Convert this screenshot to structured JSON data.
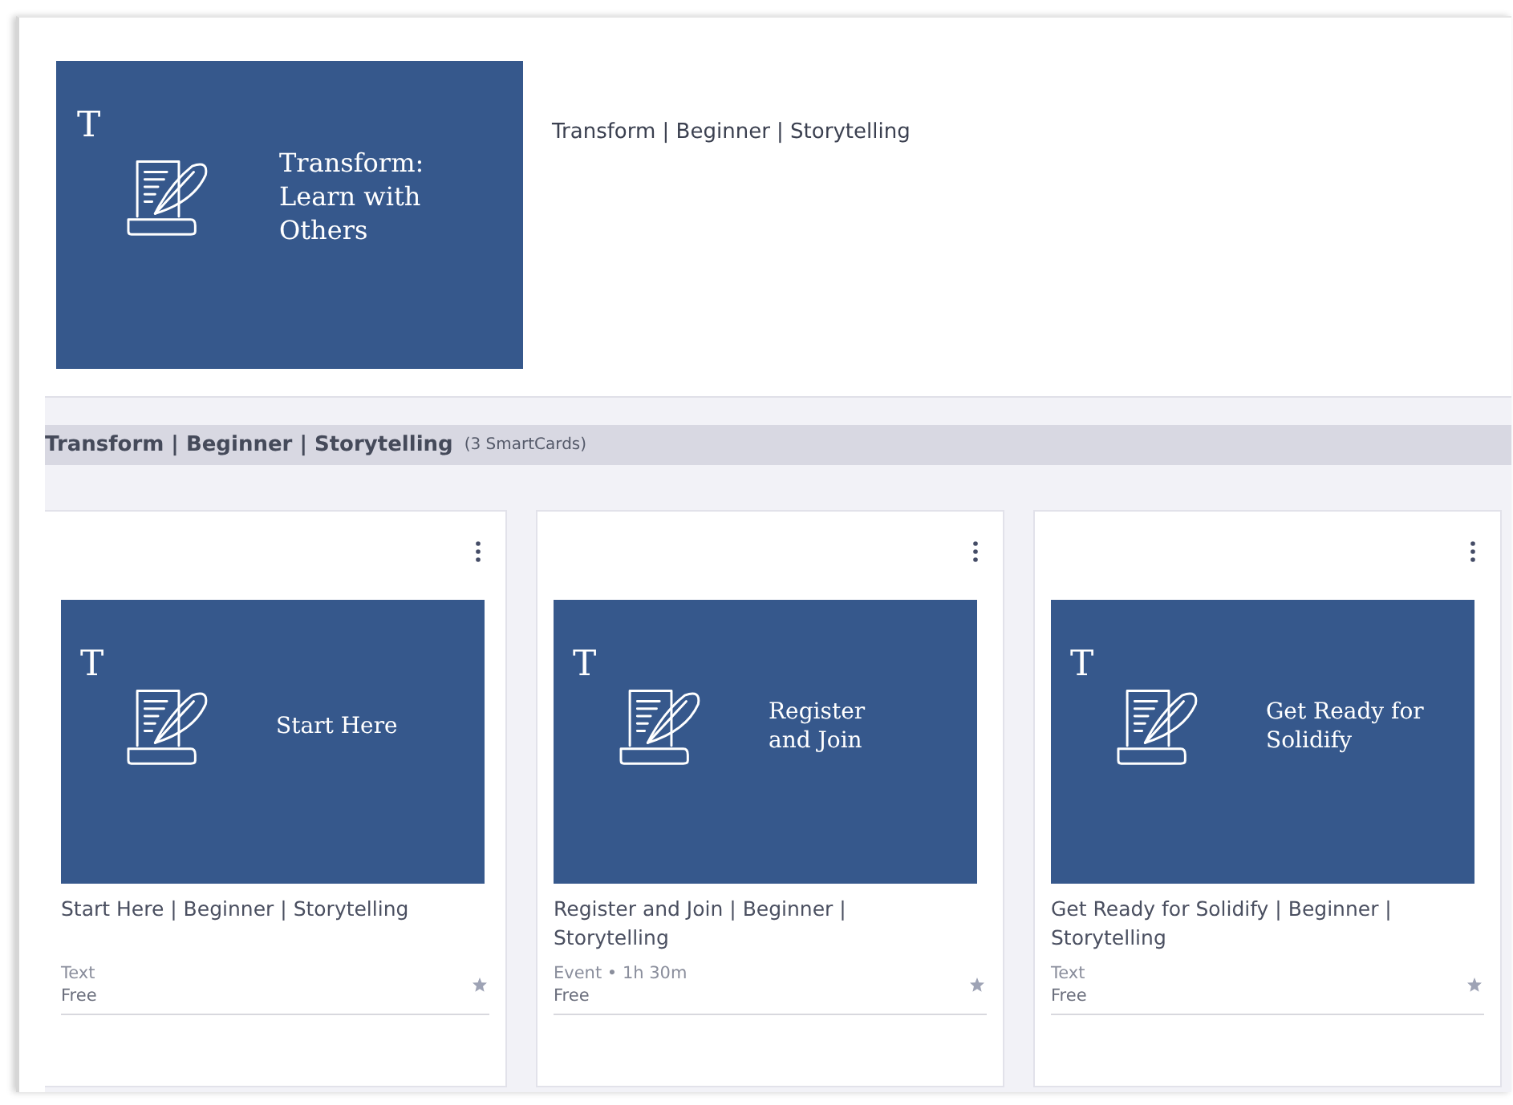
{
  "hero": {
    "tile": {
      "letter": "T",
      "title_lines": [
        "Transform:",
        "Learn with",
        "Others"
      ]
    },
    "title": "Transform | Beginner | Storytelling"
  },
  "section": {
    "title": "Transform | Beginner | Storytelling",
    "count": "(3 SmartCards)"
  },
  "cards": [
    {
      "tile": {
        "letter": "T",
        "title_lines": [
          "Start Here"
        ]
      },
      "title": "Start Here | Beginner | Storytelling",
      "meta": "Text",
      "price": "Free"
    },
    {
      "tile": {
        "letter": "T",
        "title_lines": [
          "Register",
          "and Join"
        ]
      },
      "title": "Register and Join | Beginner | Storytelling",
      "meta": "Event • 1h 30m",
      "price": "Free"
    },
    {
      "tile": {
        "letter": "T",
        "title_lines": [
          "Get Ready for",
          "Solidify"
        ]
      },
      "title": "Get Ready for Solidify | Beginner | Storytelling",
      "meta": "Text",
      "price": "Free"
    }
  ]
}
